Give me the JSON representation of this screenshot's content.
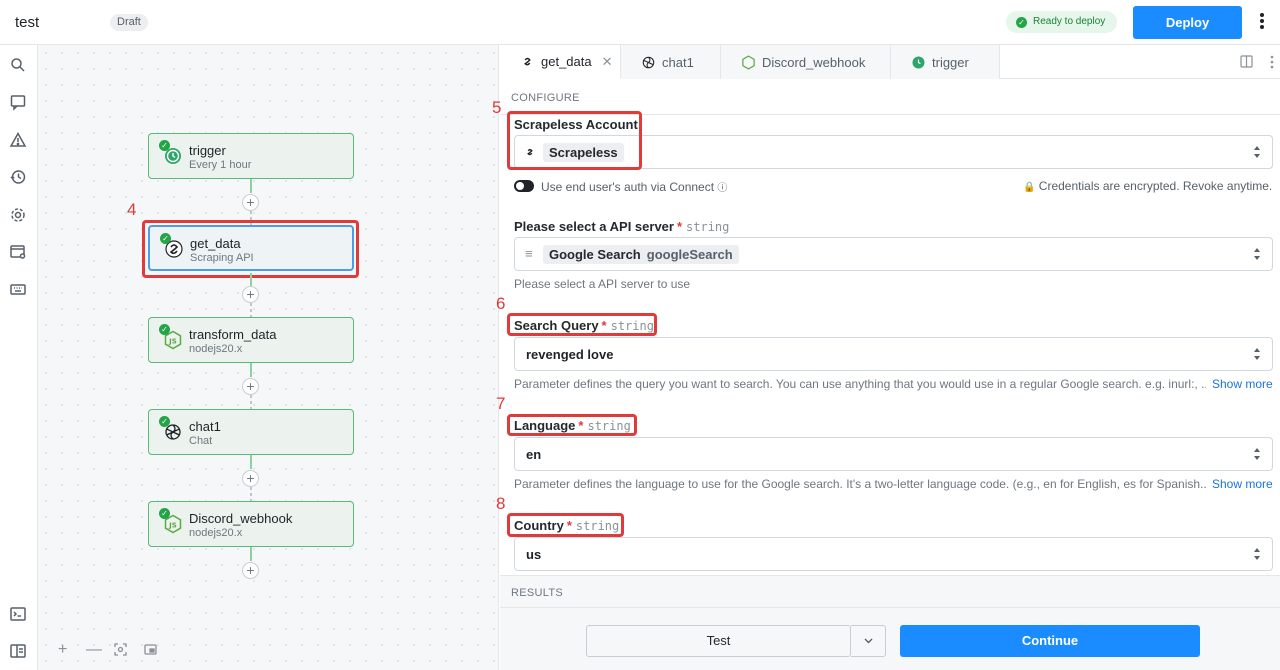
{
  "header": {
    "title": "test",
    "status_badge": "Draft",
    "ready_label": "Ready to deploy",
    "deploy_label": "Deploy"
  },
  "rail": {
    "icons": [
      "search-icon",
      "chat-icon",
      "warning-icon",
      "history-icon",
      "settings-icon",
      "browser-settings-icon",
      "keyboard-icon",
      "terminal-icon",
      "layout-icon"
    ]
  },
  "workflow": {
    "nodes": [
      {
        "name": "trigger",
        "subtitle": "Every 1 hour",
        "icon": "clock-icon"
      },
      {
        "name": "get_data",
        "subtitle": "Scraping API",
        "icon": "scrapeless-icon",
        "selected": true
      },
      {
        "name": "transform_data",
        "subtitle": "nodejs20.x",
        "icon": "nodejs-icon"
      },
      {
        "name": "chat1",
        "subtitle": "Chat",
        "icon": "openai-icon"
      },
      {
        "name": "Discord_webhook",
        "subtitle": "nodejs20.x",
        "icon": "nodejs-icon"
      }
    ],
    "annotation_numbers": {
      "get_data": "4"
    }
  },
  "tabs": [
    {
      "label": "get_data",
      "active": true,
      "closable": true
    },
    {
      "label": "chat1"
    },
    {
      "label": "Discord_webhook"
    },
    {
      "label": "trigger"
    }
  ],
  "configure": {
    "section_label": "CONFIGURE",
    "account": {
      "annotation": "5",
      "label": "Scrapeless Account",
      "value": "Scrapeless",
      "connect_toggle_label": "Use end user's auth via Connect",
      "credentials_note": "Credentials are encrypted. Revoke anytime."
    },
    "api_server": {
      "label": "Please select a API server",
      "type": "string",
      "value": "Google Search",
      "value_key": "googleSearch",
      "help": "Please select a API server to use"
    },
    "search_query": {
      "annotation": "6",
      "label": "Search Query",
      "type": "string",
      "value": "revenged love",
      "help": "Parameter defines the query you want to search. You can use anything that you would use in a regular Google search. e.g. inurl:, ...",
      "show_more": "Show more"
    },
    "language": {
      "annotation": "7",
      "label": "Language",
      "type": "string",
      "value": "en",
      "help": "Parameter defines the language to use for the Google search. It's a two-letter language code. (e.g., en for English, es for Spanish...",
      "show_more": "Show more"
    },
    "country": {
      "annotation": "8",
      "label": "Country",
      "type": "string",
      "value": "us"
    }
  },
  "results": {
    "section_label": "RESULTS"
  },
  "footer": {
    "test_label": "Test",
    "continue_label": "Continue"
  },
  "colors": {
    "accent": "#1a8cff",
    "success": "#22a447",
    "annotation_red": "#e03a3a"
  }
}
